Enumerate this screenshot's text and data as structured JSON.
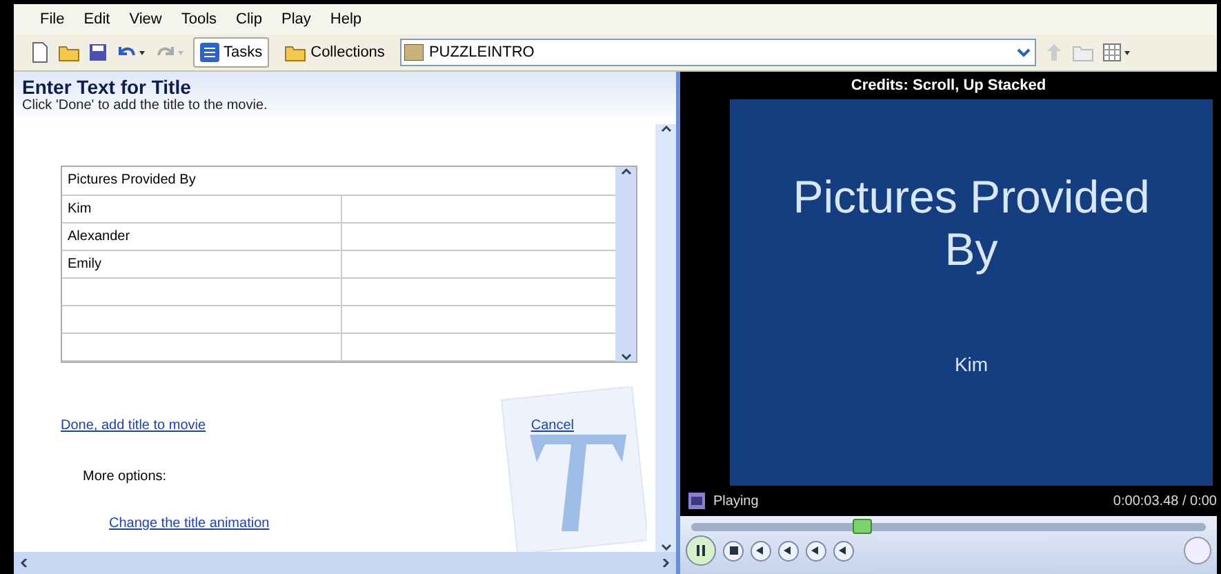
{
  "menu": [
    "File",
    "Edit",
    "View",
    "Tools",
    "Clip",
    "Play",
    "Help"
  ],
  "toolbar": {
    "tasks": {
      "label": "Tasks",
      "selected": true
    },
    "collections": {
      "label": "Collections",
      "selected": false
    },
    "project": "PUZZLEINTRO"
  },
  "task_pane": {
    "title": "Enter Text for Title",
    "hint": "Click 'Done' to add the title to the movie.",
    "table": {
      "header": "Pictures Provided By",
      "rows": [
        [
          "Kim",
          ""
        ],
        [
          "Alexander",
          ""
        ],
        [
          "Emily",
          ""
        ],
        [
          "",
          ""
        ],
        [
          "",
          ""
        ],
        [
          "",
          ""
        ]
      ]
    },
    "done_link": "Done, add title to movie",
    "cancel_link": "Cancel",
    "more_options": "More options:",
    "animation_link": "Change the title animation"
  },
  "monitor": {
    "title": "Credits: Scroll, Up Stacked",
    "preview_lines": [
      "Pictures Provided",
      "By"
    ],
    "preview_credit": "Kim",
    "status": "Playing",
    "time": "0:00:03.48 / 0:00",
    "seek": {
      "level": 0.33
    }
  }
}
